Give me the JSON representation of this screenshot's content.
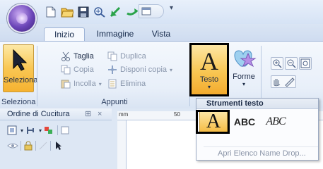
{
  "tabs": [
    {
      "label": "Inizio",
      "active": true
    },
    {
      "label": "Immagine",
      "active": false
    },
    {
      "label": "Vista",
      "active": false
    }
  ],
  "ribbon": {
    "selection_group": {
      "button_label": "Seleziona",
      "group_label": "Seleziona"
    },
    "clipboard_group": {
      "group_label": "Appunti",
      "cut": "Taglia",
      "copy": "Copia",
      "paste": "Incolla",
      "duplicate": "Duplica",
      "arrange_copies": "Disponi copia",
      "delete": "Elimina"
    },
    "text_button": "Testo",
    "shapes_button": "Forme"
  },
  "panel": {
    "title": "Ordine di Cucitura",
    "pin_glyph": "⊞",
    "close_glyph": "×"
  },
  "ruler": {
    "unit": "mm",
    "mark": "50"
  },
  "dropdown": {
    "header": "Strumenti testo",
    "items": [
      {
        "label": "A",
        "selected": true
      },
      {
        "label": "ABC",
        "selected": false
      },
      {
        "label": "ABC",
        "selected": false
      }
    ],
    "footer": "Apri Elenco Name Drop..."
  },
  "colors": {
    "accent": "#f8c652",
    "ribbon_bg": "#e8eff9",
    "highlight_border": "#000000",
    "text_red": "#c42b1c"
  }
}
